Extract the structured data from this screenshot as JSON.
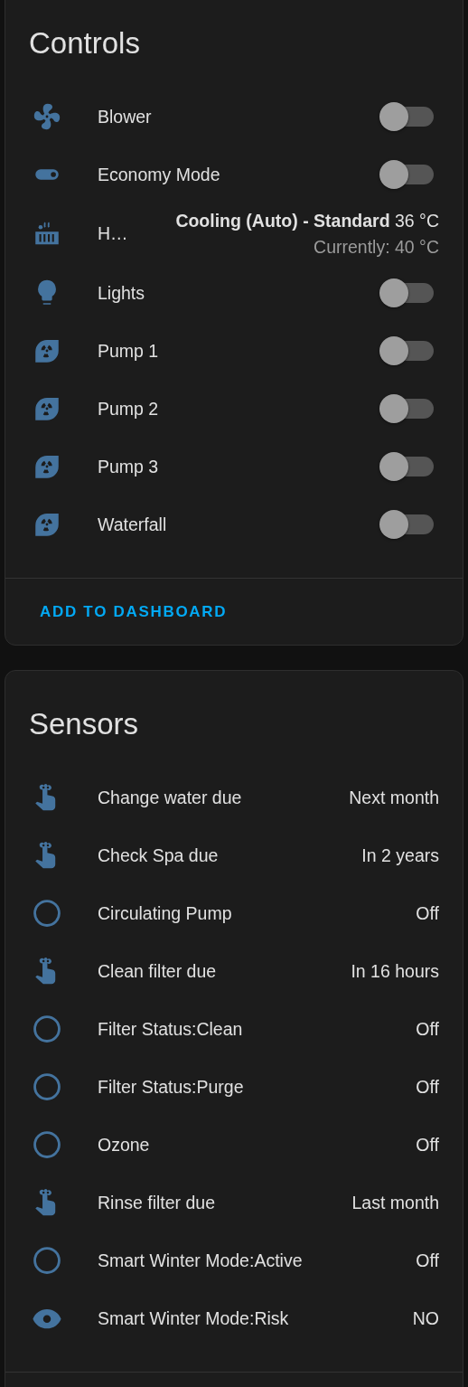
{
  "controls": {
    "title": "Controls",
    "rows": [
      {
        "kind": "fan",
        "name": "Blower",
        "on": false
      },
      {
        "kind": "switch",
        "name": "Economy Mode",
        "on": false
      },
      {
        "kind": "climate",
        "name": "H…",
        "state": "**Cooling (Auto) - Standard** 36 °C",
        "current": "Currently: 40 °C"
      },
      {
        "kind": "light",
        "name": "Lights",
        "on": false
      },
      {
        "kind": "pump",
        "name": "Pump 1",
        "on": false
      },
      {
        "kind": "pump",
        "name": "Pump 2",
        "on": false
      },
      {
        "kind": "pump",
        "name": "Pump 3",
        "on": false
      },
      {
        "kind": "pump",
        "name": "Waterfall",
        "on": false
      }
    ],
    "action": "ADD TO DASHBOARD"
  },
  "sensors": {
    "title": "Sensors",
    "rows": [
      {
        "kind": "timestamp",
        "name": "Change water due",
        "value": "Next month"
      },
      {
        "kind": "timestamp",
        "name": "Check Spa due",
        "value": "In 2 years"
      },
      {
        "kind": "binary",
        "name": "Circulating Pump",
        "value": "Off"
      },
      {
        "kind": "timestamp",
        "name": "Clean filter due",
        "value": "In 16 hours"
      },
      {
        "kind": "binary",
        "name": "Filter Status:Clean",
        "value": "Off"
      },
      {
        "kind": "binary",
        "name": "Filter Status:Purge",
        "value": "Off"
      },
      {
        "kind": "binary",
        "name": "Ozone",
        "value": "Off"
      },
      {
        "kind": "timestamp",
        "name": "Rinse filter due",
        "value": "Last month"
      },
      {
        "kind": "binary",
        "name": "Smart Winter Mode:Active",
        "value": "Off"
      },
      {
        "kind": "text",
        "name": "Smart Winter Mode:Risk",
        "value": "NO"
      }
    ]
  }
}
